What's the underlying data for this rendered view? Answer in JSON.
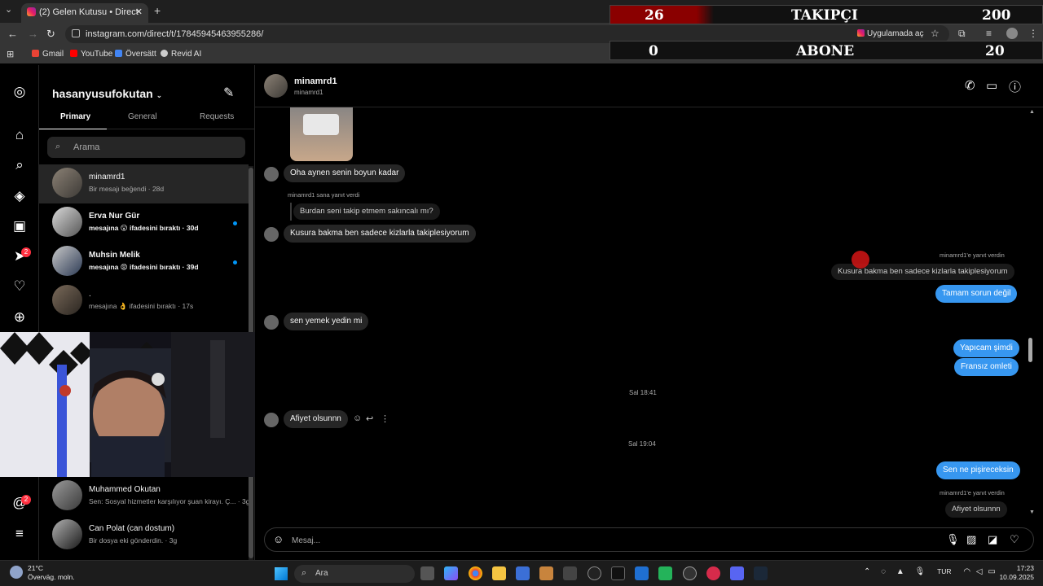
{
  "browser": {
    "tab_title": "(2) Gelen Kutusu • Direct",
    "url": "instagram.com/direct/t/17845945463955286/",
    "open_in_app": "Uygulamada aç",
    "bookmarks": [
      {
        "label": "Gmail",
        "color": "#ea4335"
      },
      {
        "label": "YouTube",
        "color": "#ff0000"
      },
      {
        "label": "Översätt",
        "color": "#4285f4"
      },
      {
        "label": "Revid AI",
        "color": "#cccccc"
      }
    ]
  },
  "overlay": {
    "followers": {
      "current": "26",
      "label": "TAKIPÇI",
      "goal": "200"
    },
    "subscribers": {
      "current": "0",
      "label": "ABONE",
      "goal": "20"
    }
  },
  "rail": {
    "notification_badge": "2",
    "activity_badge": "2"
  },
  "inbox": {
    "username": "hasanyusufokutan",
    "tabs": [
      "Primary",
      "General",
      "Requests"
    ],
    "search_placeholder": "Arama",
    "conversations": [
      {
        "name": "minamrd1",
        "preview": "Bir mesajı beğendi · 28d",
        "selected": true,
        "unread": false
      },
      {
        "name": "Erva Nur Gür",
        "preview": "mesajına 😮 ifadesini bıraktı · 30d",
        "selected": false,
        "unread": true
      },
      {
        "name": "Muhsin Melik",
        "preview": "mesajına 😡 ifadesini bıraktı · 39d",
        "selected": false,
        "unread": true
      },
      {
        "name": ".",
        "preview": "mesajına 👌 ifadesini bıraktı · 17s",
        "selected": false,
        "unread": false
      },
      {
        "name": "Muhammed Okutan",
        "preview": "Sen: Sosyal hizmetler karşılıyor şuan kirayı. Ç... · 3g",
        "selected": false,
        "unread": false
      },
      {
        "name": "Can Polat (can dostum)",
        "preview": "Bir dosya eki gönderdin. · 3g",
        "selected": false,
        "unread": false
      }
    ]
  },
  "chat": {
    "peer_name": "minamrd1",
    "peer_handle": "minamrd1",
    "messages": {
      "m1": "Oha aynen senin boyun kadar",
      "reply_note1": "minamrd1 sana yanıt verdi",
      "reply_quote1": "Burdan seni takip etmem sakıncalı mı?",
      "m2": "Kusura bakma ben sadece kizlarla takiplesiyorum",
      "reply_note2": "minamrd1'e yanıt verdin",
      "reply_quote2": "Kusura bakma ben sadece kizlarla takiplesiyorum",
      "o1": "Tamam sorun değil",
      "m3": "sen yemek yedin mi",
      "o2": "Yapıcam şimdi",
      "o3": "Fransız omleti",
      "ts1": "Sal 18:41",
      "m4": "Afiyet olsunnn",
      "ts2": "Sal 19:04",
      "o4": "Sen ne pişireceksin",
      "reply_note3": "minamrd1'e yanıt verdin",
      "reply_quote3": "Afiyet olsunnn"
    },
    "composer_placeholder": "Mesaj..."
  },
  "taskbar": {
    "temperature": "21°C",
    "weather_text": "Överväg. moln.",
    "search_label": "Ara",
    "language": "TUR",
    "time": "17:23",
    "date": "10.09.2025"
  }
}
